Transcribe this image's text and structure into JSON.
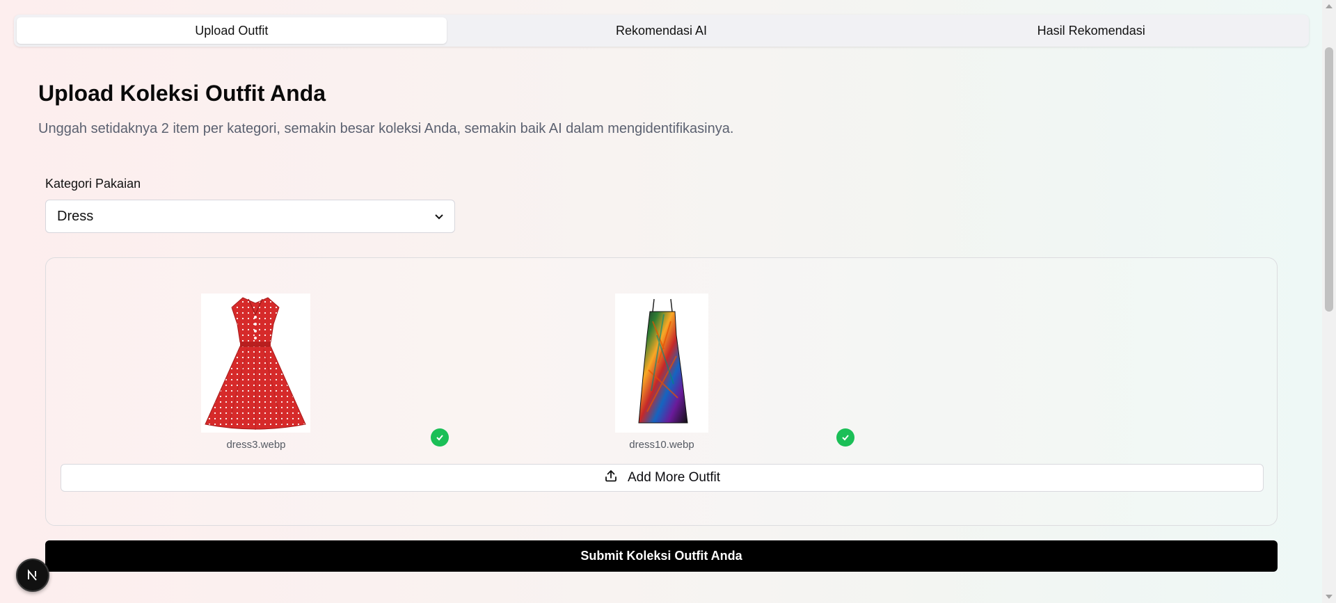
{
  "tabs": [
    {
      "label": "Upload Outfit",
      "active": true
    },
    {
      "label": "Rekomendasi AI",
      "active": false
    },
    {
      "label": "Hasil Rekomendasi",
      "active": false
    }
  ],
  "page": {
    "title": "Upload Koleksi Outfit Anda",
    "subtitle": "Unggah setidaknya 2 item per kategori, semakin besar koleksi Anda, semakin baik AI dalam mengidentifikasinya."
  },
  "category": {
    "label": "Kategori Pakaian",
    "selected": "Dress"
  },
  "uploads": [
    {
      "filename": "dress3.webp",
      "status": "uploaded",
      "image": "red-polka-dot-dress"
    },
    {
      "filename": "dress10.webp",
      "status": "uploaded",
      "image": "tropical-print-maxi-dress"
    }
  ],
  "actions": {
    "add_more": "Add More Outfit",
    "submit": "Submit Koleksi Outfit Anda"
  },
  "badge": {
    "letter": "N"
  },
  "colors": {
    "accent_green": "#1bbf57",
    "submit_bg": "#000000",
    "dress_red": "#d62a2a"
  },
  "icons": {
    "upload": "upload-icon",
    "check": "check-circle-icon",
    "chevron": "chevron-down-icon"
  }
}
